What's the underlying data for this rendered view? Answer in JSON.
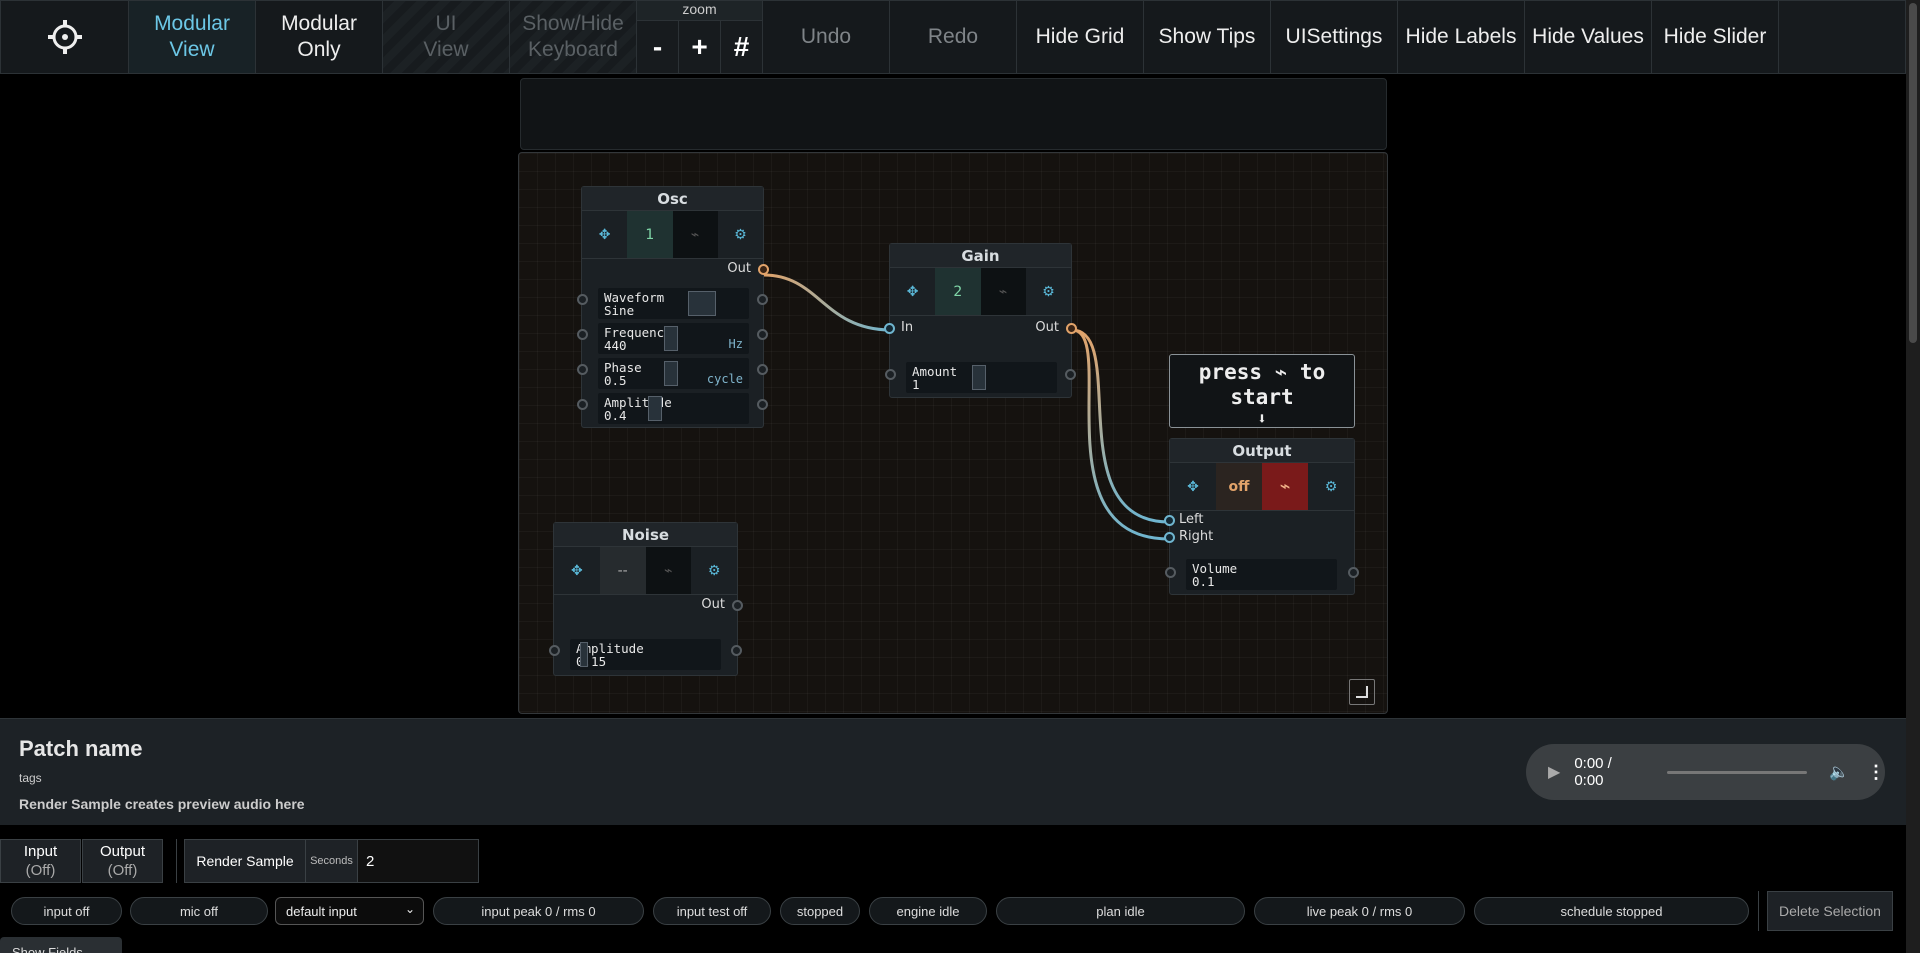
{
  "toolbar": {
    "gear_icon": "gear-icon",
    "modular_view": "Modular\nView",
    "modular_only": "Modular\nOnly",
    "ui_view": "UI\nView",
    "show_hide_keyboard": "Show/Hide\nKeyboard",
    "zoom_label": "zoom",
    "zoom_out": "-",
    "zoom_in": "+",
    "zoom_grid": "#",
    "undo": "Undo",
    "redo": "Redo",
    "hide_grid": "Hide Grid",
    "show_tips": "Show Tips",
    "ui_settings": "UISettings",
    "hide_labels": "Hide Labels",
    "hide_values": "Hide Values",
    "hide_slider": "Hide Slider"
  },
  "modules": {
    "osc": {
      "title": "Osc",
      "index": "1",
      "out": "Out",
      "params": [
        {
          "label": "Waveform",
          "value": "Sine",
          "unit": ""
        },
        {
          "label": "Frequency",
          "value": "440",
          "unit": "Hz"
        },
        {
          "label": "Phase",
          "value": "0.5",
          "unit": "cycle"
        },
        {
          "label": "Amplitude",
          "value": "0.4",
          "unit": ""
        }
      ]
    },
    "gain": {
      "title": "Gain",
      "index": "2",
      "in": "In",
      "out": "Out",
      "params": [
        {
          "label": "Amount",
          "value": "1"
        }
      ]
    },
    "noise": {
      "title": "Noise",
      "index": "--",
      "out": "Out",
      "params": [
        {
          "label": "Amplitude",
          "value": "0.15"
        }
      ]
    },
    "output": {
      "title": "Output",
      "state": "off",
      "left": "Left",
      "right": "Right",
      "params": [
        {
          "label": "Volume",
          "value": "0.1"
        }
      ]
    }
  },
  "tip": {
    "line1": "press ⌁ to",
    "line2": "start",
    "arrow": "⬇"
  },
  "colors": {
    "accent": "#5ab8d8",
    "cable_orange": "#e2a36a",
    "cable_blue": "#6fb5cf",
    "power_on": "#7a1a1a"
  },
  "patch": {
    "name": "Patch name",
    "tags": "tags",
    "description": "Render Sample creates preview audio here"
  },
  "audio": {
    "time": "0:00 / 0:00"
  },
  "io": {
    "input_label": "Input",
    "input_state": "(Off)",
    "output_label": "Output",
    "output_state": "(Off)"
  },
  "render": {
    "button": "Render Sample",
    "seconds_label": "Seconds",
    "seconds_value": "2"
  },
  "status": {
    "input": "input off",
    "mic": "mic off",
    "input_select": "default input",
    "input_peak": "input peak 0 / rms 0",
    "input_test": "input test off",
    "transport": "stopped",
    "engine": "engine idle",
    "plan": "plan idle",
    "live_peak": "live peak 0 / rms 0",
    "schedule": "schedule stopped"
  },
  "delete_selection": "Delete Selection",
  "show_fields": "Show Fields"
}
